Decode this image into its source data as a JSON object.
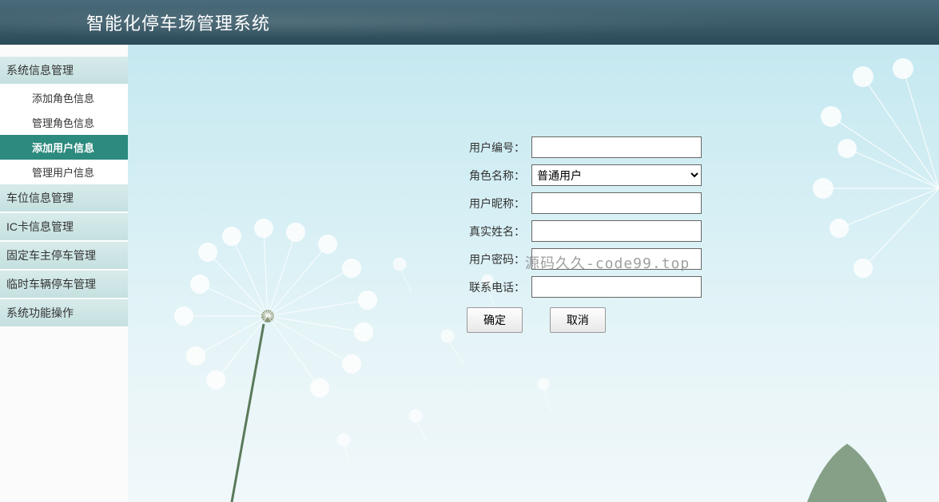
{
  "header": {
    "title": "智能化停车场管理系统"
  },
  "sidebar": {
    "groups": [
      {
        "header": "系统信息管理",
        "expanded": true,
        "items": [
          {
            "label": "添加角色信息",
            "active": false
          },
          {
            "label": "管理角色信息",
            "active": false
          },
          {
            "label": "添加用户信息",
            "active": true
          },
          {
            "label": "管理用户信息",
            "active": false
          }
        ]
      },
      {
        "header": "车位信息管理",
        "expanded": false,
        "items": []
      },
      {
        "header": "IC卡信息管理",
        "expanded": false,
        "items": []
      },
      {
        "header": "固定车主停车管理",
        "expanded": false,
        "items": []
      },
      {
        "header": "临时车辆停车管理",
        "expanded": false,
        "items": []
      },
      {
        "header": "系统功能操作",
        "expanded": false,
        "items": []
      }
    ]
  },
  "form": {
    "fields": {
      "user_id": {
        "label": "用户编号：",
        "value": ""
      },
      "role_name": {
        "label": "角色名称：",
        "selected": "普通用户"
      },
      "nickname": {
        "label": "用户昵称：",
        "value": ""
      },
      "real_name": {
        "label": "真实姓名：",
        "value": ""
      },
      "password": {
        "label": "用户密码：",
        "value": ""
      },
      "phone": {
        "label": "联系电话：",
        "value": ""
      }
    },
    "buttons": {
      "ok": "确定",
      "cancel": "取消"
    }
  },
  "watermark": "源码久久-code99.top"
}
